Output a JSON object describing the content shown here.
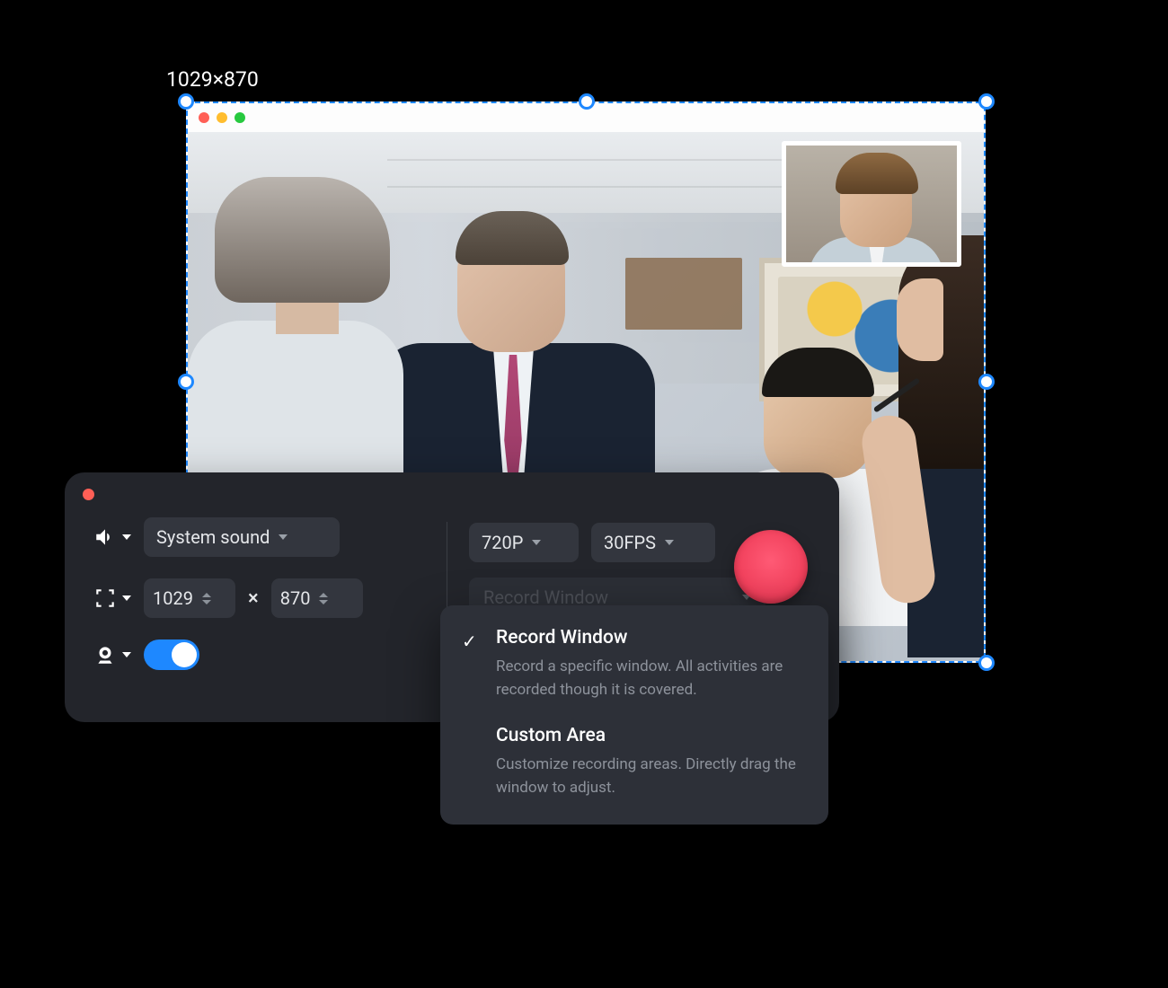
{
  "dimensions_label": "1029×870",
  "panel": {
    "audio": {
      "source": "System sound"
    },
    "size": {
      "width": "1029",
      "height": "870"
    },
    "resolution": "720P",
    "fps": "30FPS",
    "record_mode_selected": "Record Window",
    "camera_enabled": true
  },
  "dropdown": {
    "options": [
      {
        "title": "Record Window",
        "desc": "Record a specific window. All activities are recorded though it is covered.",
        "selected": true
      },
      {
        "title": "Custom Area",
        "desc": "Customize recording areas. Directly drag the window to adjust.",
        "selected": false
      }
    ]
  },
  "separators": {
    "times": "×"
  }
}
